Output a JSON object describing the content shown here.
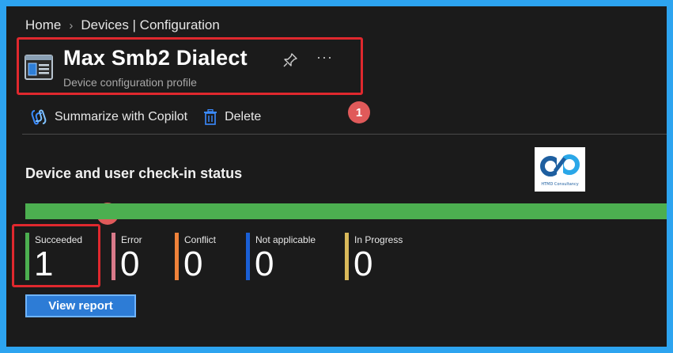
{
  "breadcrumb": {
    "items": [
      "Home",
      "Devices | Configuration"
    ]
  },
  "header": {
    "title": "Max Smb2 Dialect",
    "subtitle": "Device configuration profile",
    "more_label": "···"
  },
  "annotations": {
    "badge_1": "1",
    "badge_2": "2"
  },
  "toolbar": {
    "summarize_label": "Summarize with Copilot",
    "delete_label": "Delete"
  },
  "status": {
    "title": "Device and user check-in status",
    "progress_fraction": 1.0,
    "progress_color": "#4caf50",
    "items": [
      {
        "label": "Succeeded",
        "value": "1",
        "color": "#4caf50"
      },
      {
        "label": "Error",
        "value": "0",
        "color": "#d97a8a"
      },
      {
        "label": "Conflict",
        "value": "0",
        "color": "#f0823a"
      },
      {
        "label": "Not applicable",
        "value": "0",
        "color": "#1a5fd6"
      },
      {
        "label": "In Progress",
        "value": "0",
        "color": "#d9b95a"
      }
    ],
    "view_report_label": "View report"
  },
  "logo": {
    "text": "HTMD Consultancy"
  },
  "colors": {
    "frame_border": "#2da4f0",
    "highlight": "#e0282e",
    "badge": "#e05a5a",
    "accent": "#2d7cd6"
  }
}
